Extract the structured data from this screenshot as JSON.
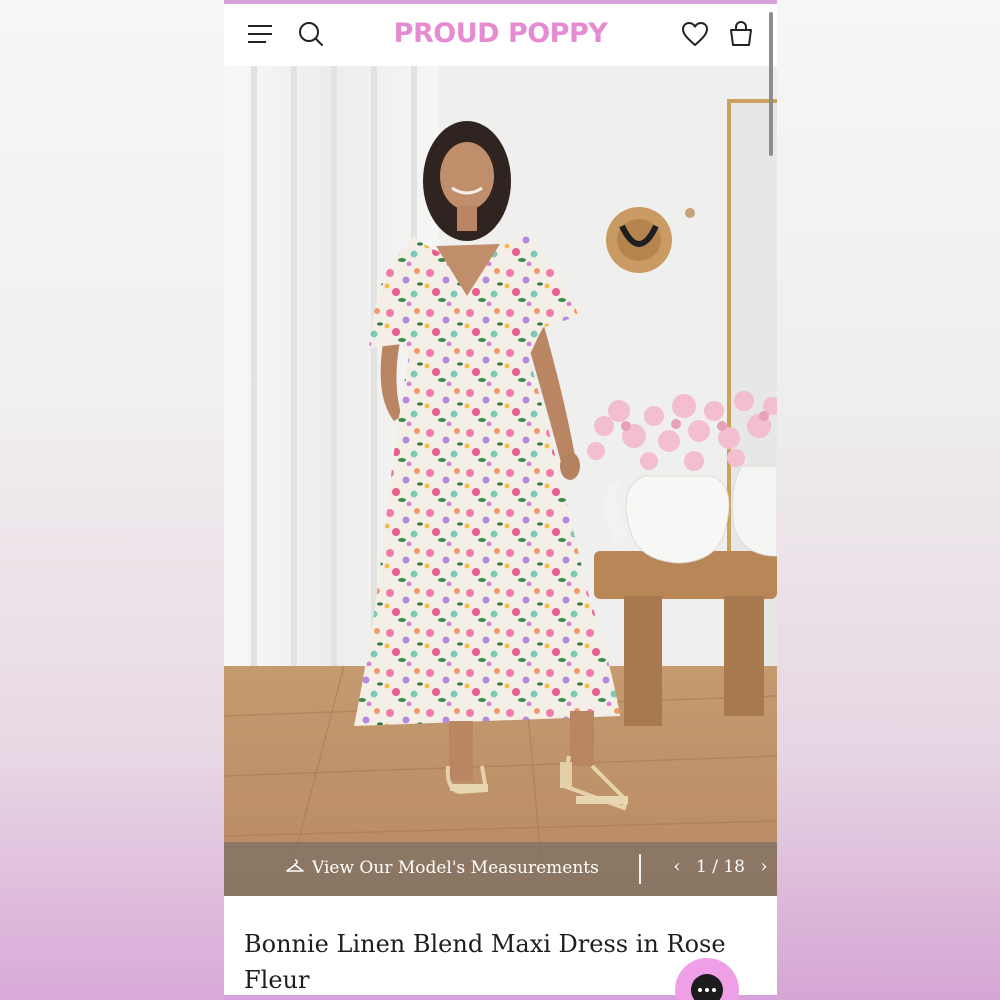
{
  "header": {
    "brand": "PROUD POPPY",
    "menu_icon": "hamburger-menu-icon",
    "search_icon": "search-icon",
    "wishlist_icon": "heart-icon",
    "cart_icon": "shopping-bag-icon"
  },
  "gallery": {
    "measurements_label": "View Our Model's Measurements",
    "measurements_icon": "hanger-icon",
    "pager": "1 / 18",
    "prev_icon": "chevron-left-icon",
    "next_icon": "chevron-right-icon"
  },
  "product": {
    "title": "Bonnie Linen Blend Maxi Dress in Rose Fleur"
  },
  "chat": {
    "icon": "chat-bubble-icon"
  },
  "colors": {
    "brand": "#e58bd2",
    "accent_line": "#d7a3dd",
    "chat_button": "#ef9fe6"
  }
}
